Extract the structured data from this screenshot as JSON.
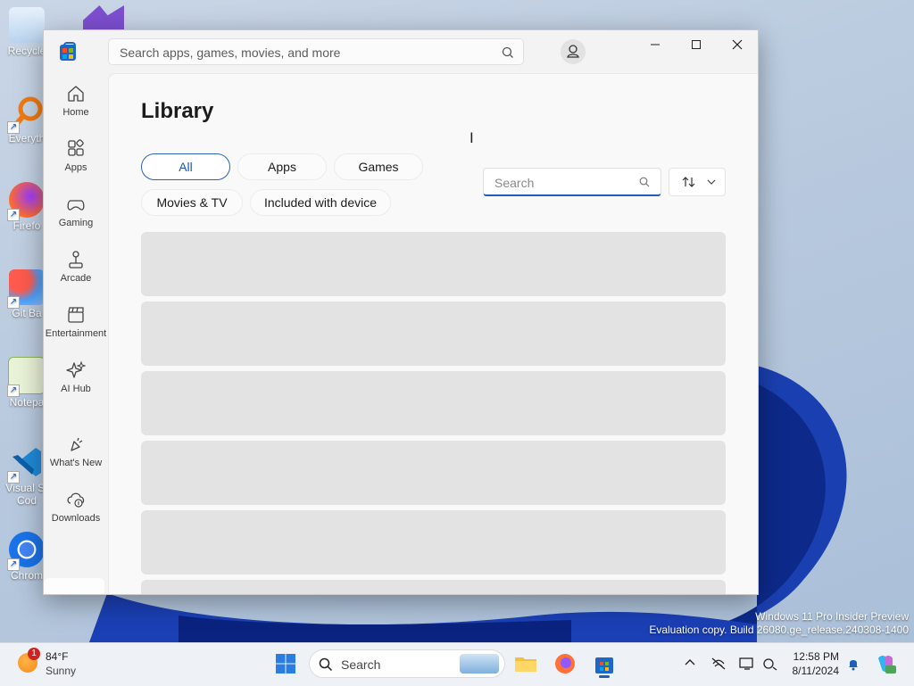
{
  "desktop": {
    "icons": [
      {
        "name": "recycle-bin",
        "label": "Recycle"
      },
      {
        "name": "everything",
        "label": "Everyth"
      },
      {
        "name": "firefox",
        "label": "Firefo"
      },
      {
        "name": "git-bash",
        "label": "Git Ba"
      },
      {
        "name": "notepad",
        "label": "Notepa"
      },
      {
        "name": "visual-studio-code",
        "label": "Visual St"
      },
      {
        "name": "chrome",
        "label": "Chrom"
      }
    ],
    "vscode_label_line2": "Cod",
    "watermark_line1": "Windows 11 Pro Insider Preview",
    "watermark_line2": "Evaluation copy. Build 26080.ge_release.240308-1400"
  },
  "window": {
    "search_placeholder": "Search apps, games, movies, and more",
    "icons": {
      "search": "search-icon",
      "account": "account-icon",
      "minimize": "minimize-icon",
      "maximize": "maximize-icon",
      "close": "close-icon"
    }
  },
  "sidebar": {
    "items": [
      {
        "label": "Home",
        "icon": "home-icon"
      },
      {
        "label": "Apps",
        "icon": "apps-icon"
      },
      {
        "label": "Gaming",
        "icon": "gamepad-icon"
      },
      {
        "label": "Arcade",
        "icon": "joystick-icon"
      },
      {
        "label": "Entertainment",
        "icon": "clapperboard-icon"
      },
      {
        "label": "AI Hub",
        "icon": "sparkle-icon"
      },
      {
        "label": "What's New",
        "icon": "whats-new-icon"
      },
      {
        "label": "Downloads",
        "icon": "downloads-icon"
      }
    ],
    "active_item_icon": "library-icon"
  },
  "library": {
    "title": "Library",
    "filters": [
      "All",
      "Apps",
      "Games",
      "Movies & TV",
      "Included with device"
    ],
    "active_filter": "All",
    "search_placeholder": "Search",
    "sort_icon": "sort-icon",
    "loading_rows": 6
  },
  "taskbar": {
    "weather_badge": "1",
    "temperature": "84°F",
    "condition": "Sunny",
    "search_label": "Search",
    "time": "12:58 PM",
    "date": "8/11/2024",
    "pinned": [
      "file-explorer-icon",
      "firefox-icon",
      "microsoft-store-icon"
    ],
    "tray": [
      "chevron-up-icon",
      "network-off-icon",
      "display-icon",
      "accessibility-icon",
      "notification-bell-icon",
      "copilot-icon"
    ]
  },
  "colors": {
    "accent": "#1f5fb8",
    "skeleton": "#e3e3e3"
  }
}
